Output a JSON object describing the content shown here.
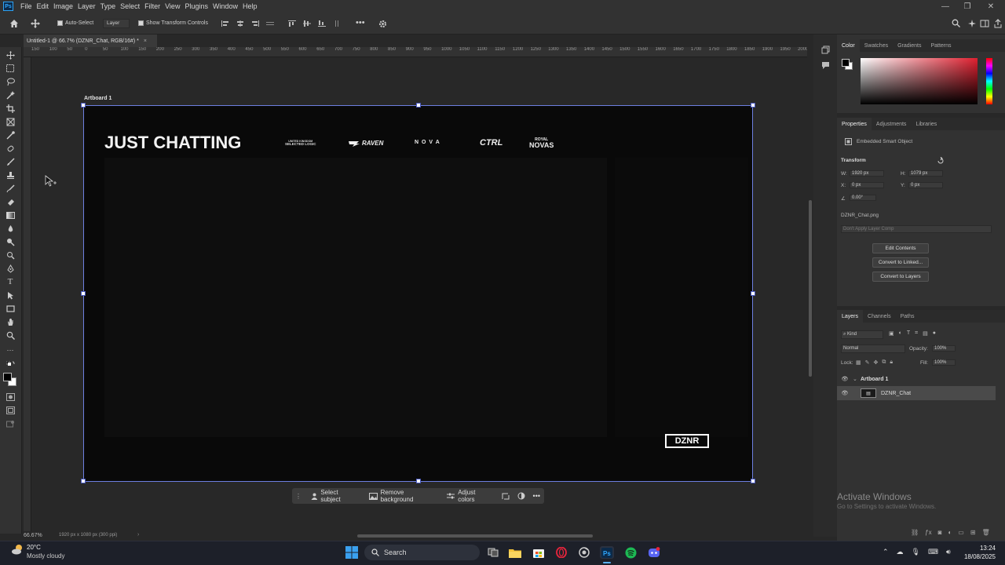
{
  "menubar": {
    "items": [
      "File",
      "Edit",
      "Image",
      "Layer",
      "Type",
      "Select",
      "Filter",
      "View",
      "Plugins",
      "Window",
      "Help"
    ]
  },
  "options_bar": {
    "auto_select_label": "Auto-Select",
    "layer_select_value": "Layer",
    "show_transform_label": "Show Transform Controls"
  },
  "document_tab": {
    "title": "Untitled-1 @ 66.7% (DZNR_Chat, RGB/16#) *"
  },
  "ruler": {
    "labels": [
      "150",
      "100",
      "50",
      "0",
      "50",
      "100",
      "150",
      "200",
      "250",
      "300",
      "350",
      "400",
      "450",
      "500",
      "550",
      "600",
      "650",
      "700",
      "750",
      "800",
      "850",
      "900",
      "950",
      "1000",
      "1050",
      "1100",
      "1150",
      "1200",
      "1250",
      "1300",
      "1350",
      "1400",
      "1450",
      "1500",
      "1550",
      "1600",
      "1650",
      "1700",
      "1750",
      "1800",
      "1850",
      "1900",
      "1950",
      "2000"
    ]
  },
  "artboard": {
    "label": "Artboard 1",
    "title": "JUST CHATTING",
    "sponsors": {
      "united_kingdom": "UNITED KINGDOM",
      "selected_logic": "SELECTED LOGIC",
      "raven": "RAVEN",
      "nova": "N O V A",
      "ctrl": "CTRL",
      "royal": "ROYAL",
      "novas": "NOVAS"
    },
    "logo": "DZNR"
  },
  "contextual_taskbar": {
    "select_subject": "Select subject",
    "remove_background": "Remove background",
    "adjust_colors": "Adjust colors"
  },
  "status": {
    "zoom": "66.67%",
    "doc_size": "1920 px x 1080 px (300 ppi)"
  },
  "color_panel": {
    "tabs": [
      "Color",
      "Swatches",
      "Gradients",
      "Patterns"
    ],
    "active_tab": "Color",
    "picker_base_color": "#e02030"
  },
  "properties_panel": {
    "tabs": [
      "Properties",
      "Adjustments",
      "Libraries"
    ],
    "type_label": "Embedded Smart Object",
    "transform_label": "Transform",
    "w_label": "W:",
    "w_value": "1920 px",
    "h_label": "H:",
    "h_value": "1079 px",
    "x_label": "X:",
    "x_value": "0 px",
    "y_label": "Y:",
    "y_value": "0 px",
    "angle_value": "0.00°",
    "filename": "DZNR_Chat.png",
    "layer_comp_placeholder": "Don't Apply Layer Comp",
    "buttons": [
      "Edit Contents",
      "Convert to Linked...",
      "Convert to Layers"
    ]
  },
  "layers_panel": {
    "tabs": [
      "Layers",
      "Channels",
      "Paths"
    ],
    "filter_kind": "Kind",
    "blend_mode": "Normal",
    "opacity_label": "Opacity:",
    "opacity_value": "100%",
    "lock_label": "Lock:",
    "fill_label": "Fill:",
    "fill_value": "100%",
    "layers": [
      {
        "name": "Artboard 1",
        "type": "artboard"
      },
      {
        "name": "DZNR_Chat",
        "type": "smart-object",
        "selected": true
      }
    ]
  },
  "watermark": {
    "line1": "Activate Windows",
    "line2": "Go to Settings to activate Windows."
  },
  "taskbar": {
    "weather_temp": "20°C",
    "weather_desc": "Mostly cloudy",
    "search_placeholder": "Search",
    "time": "13:24",
    "date": "18/08/2025"
  },
  "colors": {
    "accent_selection": "#6d7fe0",
    "ps_blue": "#31a8ff",
    "spotify_green": "#1db954"
  }
}
